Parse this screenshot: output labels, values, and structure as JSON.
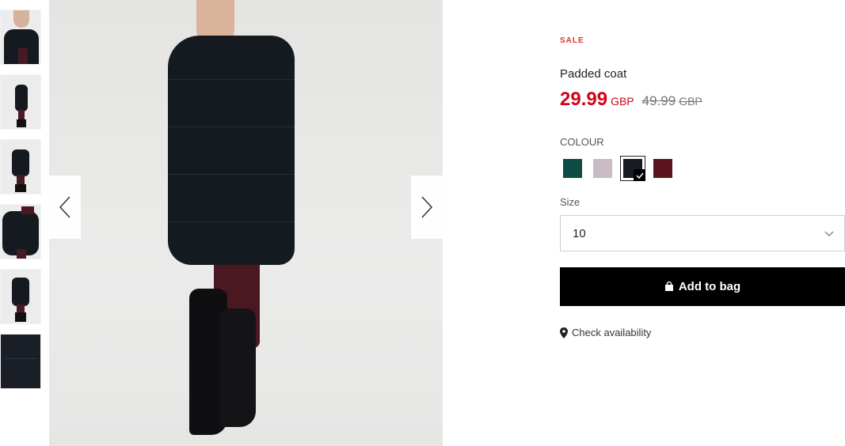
{
  "product": {
    "badge": "SALE",
    "title": "Padded coat",
    "price_now": "29.99",
    "price_now_currency": "GBP",
    "price_old": "49.99",
    "price_old_currency": "GBP"
  },
  "colour": {
    "label": "COLOUR",
    "options": [
      {
        "name": "teal",
        "hex": "#0f4a44"
      },
      {
        "name": "lilac-grey",
        "hex": "#c9bcc4"
      },
      {
        "name": "black",
        "hex": "#171b24",
        "selected": true
      },
      {
        "name": "burgundy",
        "hex": "#5c151c"
      }
    ]
  },
  "size": {
    "label": "Size",
    "selected": "10"
  },
  "actions": {
    "add_to_bag": "Add to bag",
    "check_availability": "Check availability"
  },
  "gallery": {
    "thumbnail_count": 6,
    "icons": [
      "chevron-left-icon",
      "chevron-right-icon",
      "bag-icon",
      "location-pin-icon",
      "checkmark-icon",
      "chevron-down-icon"
    ]
  }
}
